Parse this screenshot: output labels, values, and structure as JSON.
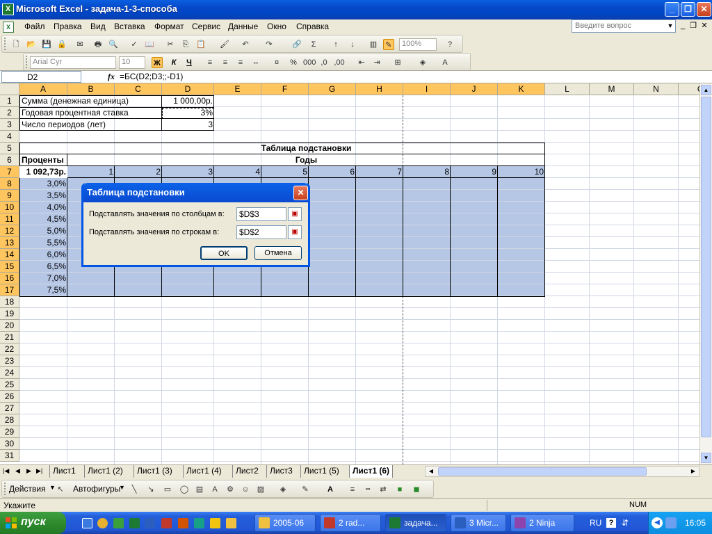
{
  "window": {
    "title": "Microsoft Excel - задача-1-3-способа"
  },
  "menu": {
    "items": [
      "Файл",
      "Правка",
      "Вид",
      "Вставка",
      "Формат",
      "Сервис",
      "Данные",
      "Окно",
      "Справка"
    ],
    "question_placeholder": "Введите вопрос"
  },
  "toolbar": {
    "zoom": "100%",
    "font": "Arial Cyr",
    "size": "10",
    "bold": "Ж",
    "italic": "К",
    "underline": "Ч"
  },
  "formula_bar": {
    "name_box": "D2",
    "fx": "fx",
    "formula": "=БС(D2;D3;;-D1)"
  },
  "grid": {
    "columns": [
      "A",
      "B",
      "C",
      "D",
      "E",
      "F",
      "G",
      "H",
      "I",
      "J",
      "K",
      "L",
      "M",
      "N",
      "O"
    ],
    "rows": [
      "1",
      "2",
      "3",
      "4",
      "5",
      "6",
      "7",
      "8",
      "9",
      "10",
      "11",
      "12",
      "13",
      "14",
      "15",
      "16",
      "17",
      "18",
      "19",
      "20",
      "21",
      "22",
      "23",
      "24",
      "25",
      "26",
      "27",
      "28",
      "29",
      "30",
      "31"
    ],
    "a1": "Сумма (денежная единица)",
    "a2": "Годовая процентная ставка",
    "a3": "Число периодов (лет)",
    "d1": "1 000,00р.",
    "d2": "3%",
    "d3": "3",
    "title5": "Таблица подстановки",
    "a6": "Проценты",
    "years": "Годы",
    "a7": "1 092,73р.",
    "year_values": [
      "1",
      "2",
      "3",
      "4",
      "5",
      "6",
      "7",
      "8",
      "9",
      "10"
    ],
    "rates": [
      "3,0%",
      "3,5%",
      "4,0%",
      "4,5%",
      "5,0%",
      "5,5%",
      "6,0%",
      "6,5%",
      "7,0%",
      "7,5%"
    ]
  },
  "dialog": {
    "title": "Таблица подстановки",
    "col_label": "Подставлять значения по столбцам в:",
    "col_value": "$D$3",
    "row_label": "Подставлять значения по строкам в:",
    "row_value": "$D$2",
    "ok": "OK",
    "cancel": "Отмена"
  },
  "sheet_tabs": [
    "Лист1",
    "Лист1 (2)",
    "Лист1 (3)",
    "Лист1 (4)",
    "Лист2",
    "Лист3",
    "Лист1 (5)",
    "Лист1 (6)"
  ],
  "drawing": {
    "actions": "Действия",
    "autoshapes": "Автофигуры"
  },
  "status": {
    "mode": "Укажите",
    "num": "NUM"
  },
  "taskbar": {
    "start": "пуск",
    "tasks": [
      "2005-06",
      "2 rad...",
      "задача...",
      "3 Micr...",
      "2 Ninja"
    ],
    "lang": "RU",
    "clock": "16:05"
  }
}
